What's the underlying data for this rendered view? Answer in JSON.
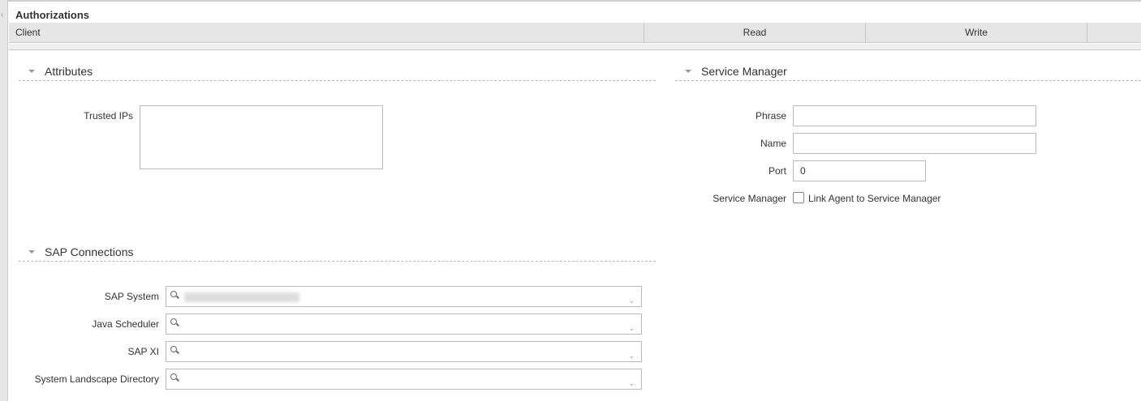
{
  "header": {
    "title": "Authorizations",
    "columns": [
      "Client",
      "Read",
      "Write"
    ]
  },
  "attributes": {
    "title": "Attributes",
    "trusted_ips_label": "Trusted IPs",
    "trusted_ips_value": ""
  },
  "service_manager": {
    "title": "Service Manager",
    "phrase_label": "Phrase",
    "phrase_value": "",
    "name_label": "Name",
    "name_value": "",
    "port_label": "Port",
    "port_value": "0",
    "sm_label": "Service Manager",
    "checkbox_label": "Link Agent to Service Manager",
    "checked": false
  },
  "sap": {
    "title": "SAP Connections",
    "fields": [
      {
        "label": "SAP System"
      },
      {
        "label": "Java Scheduler"
      },
      {
        "label": "SAP XI"
      },
      {
        "label": "System Landscape Directory"
      }
    ]
  },
  "icons": {
    "collapse": "chevron-left-icon",
    "search": "search-icon",
    "dropdown": "chevron-down-icon"
  }
}
